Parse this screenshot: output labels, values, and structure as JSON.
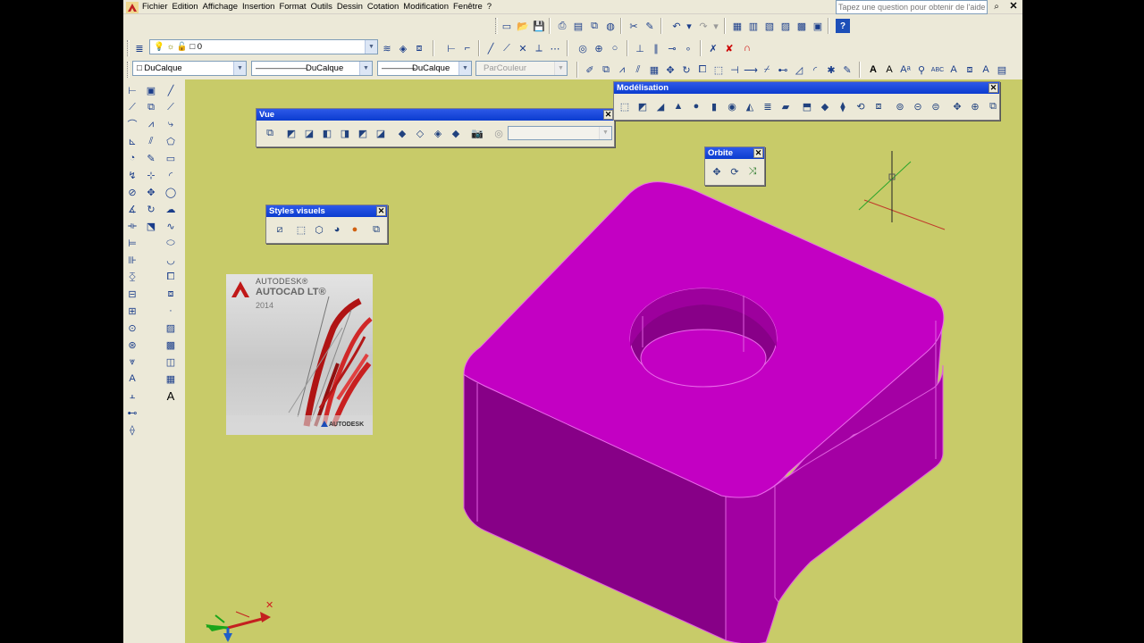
{
  "menu": [
    "Fichier",
    "Edition",
    "Affichage",
    "Insertion",
    "Format",
    "Outils",
    "Dessin",
    "Cotation",
    "Modification",
    "Fenêtre",
    "?"
  ],
  "help": {
    "placeholder": "Tapez une question pour obtenir de l'aide"
  },
  "layers": {
    "current": "0"
  },
  "properties": {
    "color": "DuCalque",
    "linetype": "DuCalque",
    "lineweight": "DuCalque",
    "plotstyle": "ParCouleur"
  },
  "palettes": {
    "vue": {
      "title": "Vue"
    },
    "modelisation": {
      "title": "Modélisation"
    },
    "orbite": {
      "title": "Orbite"
    },
    "styles": {
      "title": "Styles visuels"
    }
  },
  "splash": {
    "brand": "AUTODESK®",
    "product": "AUTOCAD LT®",
    "year": "2014",
    "footer": "AUTODESK"
  },
  "ucs": {
    "x_mark": "✕"
  },
  "colors": {
    "model": "#c300c3",
    "background": "#c8cb69",
    "titlebar": "#0b3ccf"
  }
}
